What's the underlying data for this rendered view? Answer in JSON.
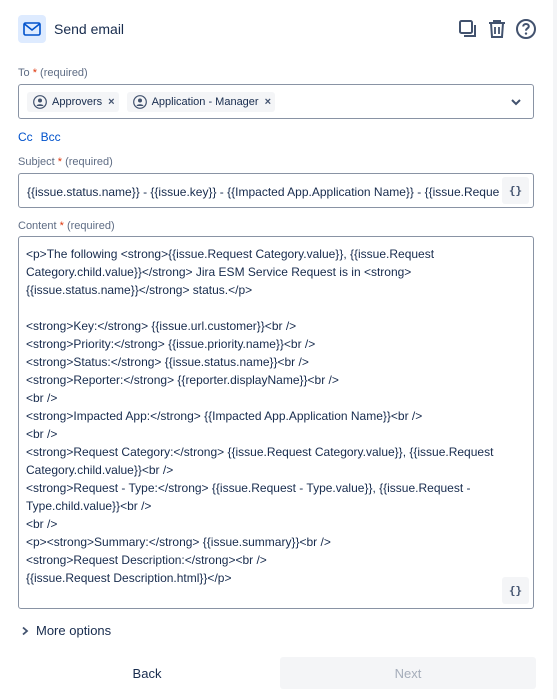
{
  "header": {
    "title": "Send email",
    "icons": [
      "mail-icon",
      "duplicate-icon",
      "delete-icon",
      "help-icon"
    ]
  },
  "to": {
    "label": "To",
    "required_star": "*",
    "required_text": "(required)",
    "recipients": [
      {
        "label": "Approvers",
        "icon": "person-icon"
      },
      {
        "label": "Application - Manager",
        "icon": "person-icon"
      }
    ],
    "remove_glyph": "×"
  },
  "cc_label": "Cc",
  "bcc_label": "Bcc",
  "subject": {
    "label": "Subject",
    "required_star": "*",
    "required_text": "(required)",
    "value": "{{issue.status.name}} - {{issue.key}} - {{Impacted App.Application Name}} - {{issue.Request Category.value}}"
  },
  "content": {
    "label": "Content",
    "required_star": "*",
    "required_text": "(required)",
    "value": "<p>The following <strong>{{issue.Request Category.value}}, {{issue.Request Category.child.value}}</strong> Jira ESM Service Request is in <strong>{{issue.status.name}}</strong> status.</p>\n\n<strong>Key:</strong> {{issue.url.customer}}<br />\n<strong>Priority:</strong> {{issue.priority.name}}<br />\n<strong>Status:</strong> {{issue.status.name}}<br />\n<strong>Reporter:</strong> {{reporter.displayName}}<br />\n<br />\n<strong>Impacted App:</strong> {{Impacted App.Application Name}}<br />\n<br />\n<strong>Request Category:</strong> {{issue.Request Category.value}}, {{issue.Request Category.child.value}}<br />\n<strong>Request - Type:</strong> {{issue.Request - Type.value}}, {{issue.Request - Type.child.value}}<br />\n<br />\n<p><strong>Summary:</strong> {{issue.summary}}<br />\n<strong>Request Description:</strong><br />\n{{issue.Request Description.html}}</p>"
  },
  "smart_value_button": "{}",
  "more_options": "More options",
  "buttons": {
    "back": "Back",
    "next": "Next"
  },
  "colors": {
    "accent": "#0052cc",
    "required": "#de350b",
    "mail_badge": "#deebff"
  }
}
